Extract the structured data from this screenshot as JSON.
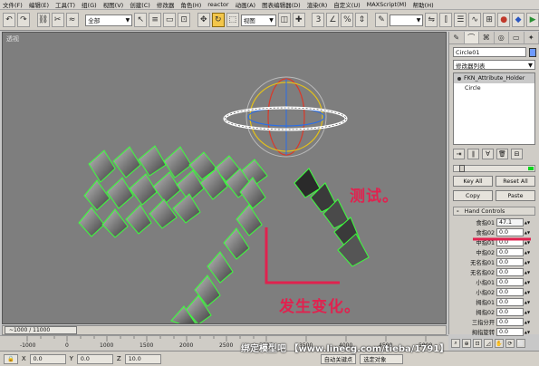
{
  "menu": [
    "文件(F)",
    "编辑(E)",
    "工具(T)",
    "组(G)",
    "视图(V)",
    "创建(C)",
    "修改器",
    "角色(H)",
    "reactor",
    "动画(A)",
    "图表编辑器(D)",
    "渲染(R)",
    "自定义(U)",
    "MAXScript(M)",
    "帮助(H)"
  ],
  "toolbar": {
    "selection_filter": "全部",
    "ref_coord": "视图"
  },
  "viewport": {
    "label": "透视",
    "annotation_test": "测试。",
    "annotation_change": "发生变化。"
  },
  "panel": {
    "object_name": "Circle01",
    "modifier_list": "修改器列表",
    "stack": [
      "FKN_Attribute_Holder",
      "Circle"
    ],
    "buttons": {
      "key_all": "Key All",
      "reset_all": "Reset All",
      "copy": "Copy",
      "paste": "Paste"
    },
    "rollout_title": "Hand Controls",
    "rollout_sign": "-",
    "controls": [
      {
        "label": "食指01",
        "value": "47.1"
      },
      {
        "label": "食指02",
        "value": "0.0"
      },
      {
        "label": "中指01",
        "value": "0.0"
      },
      {
        "label": "中指02",
        "value": "0.0"
      },
      {
        "label": "无名指01",
        "value": "0.0"
      },
      {
        "label": "无名指02",
        "value": "0.0"
      },
      {
        "label": "小指01",
        "value": "0.0"
      },
      {
        "label": "小指02",
        "value": "0.0"
      },
      {
        "label": "拇指01",
        "value": "0.0"
      },
      {
        "label": "拇指02",
        "value": "0.0"
      },
      {
        "label": "三指分开",
        "value": "0.0"
      },
      {
        "label": "拇指旋转",
        "value": "0.0"
      }
    ]
  },
  "timeline": {
    "slider_text": "~1000 / 11000",
    "ticks": [
      "-1000",
      "0",
      "1000",
      "1500",
      "2000",
      "2500",
      "3000",
      "3500",
      "4000",
      "4500",
      "5000"
    ]
  },
  "status": {
    "x_label": "X",
    "x_value": "0.0",
    "y_label": "Y",
    "y_value": "0.0",
    "z_label": "Z",
    "z_value": "10.0",
    "auto_key": "自动关键点",
    "selected": "选定对象"
  },
  "watermark": "绑定模型吧 【www.linecg.com/tieba/1791】",
  "colors": {
    "annotation": "#e0224f",
    "underline": "#e0224f",
    "wire": "#3cff3c",
    "circle_selected": "#ffffff"
  }
}
